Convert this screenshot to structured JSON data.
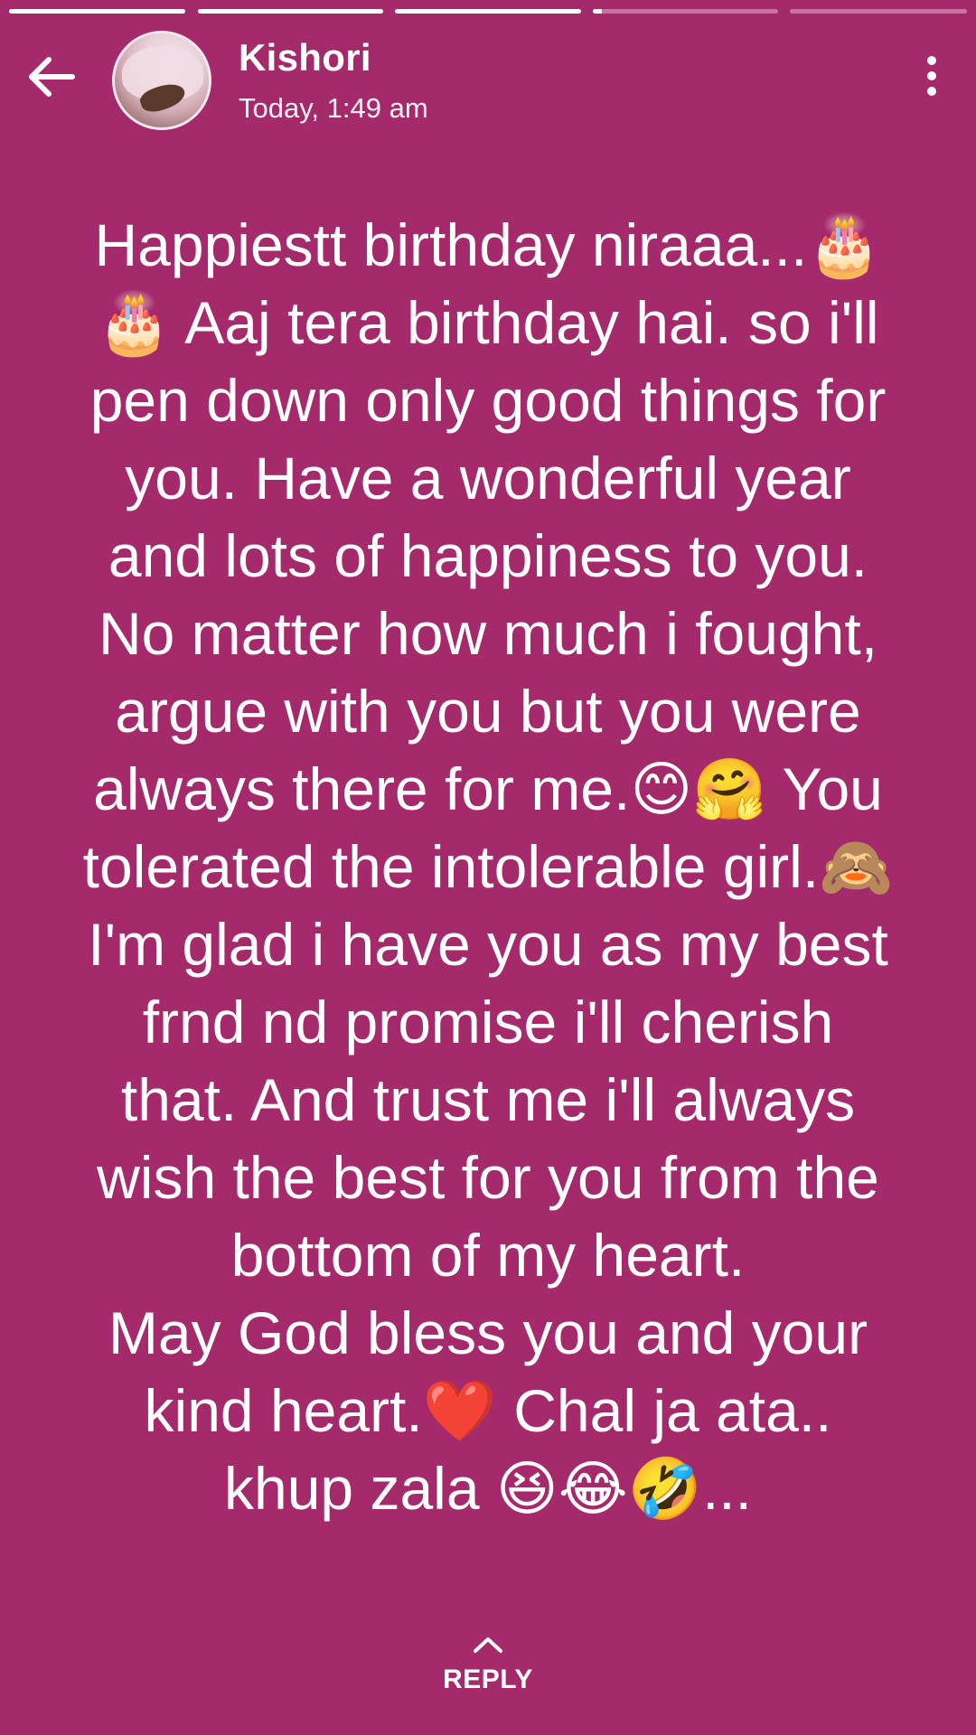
{
  "story": {
    "progress": [
      1.0,
      1.0,
      1.0,
      0.05,
      0.0
    ]
  },
  "header": {
    "name": "Kishori",
    "time": "Today, 1:49 am",
    "back_icon": "arrow-left-icon",
    "menu_icon": "more-vertical-icon"
  },
  "message": {
    "text": "Happiestt birthday niraaa...🎂\n🎂 Aaj tera birthday hai. so i'll\npen down only good things for\nyou. Have a wonderful year\nand lots of happiness to you.\nNo matter how much i fought,\nargue with you but you were\nalways  there for me.😊🤗 You\ntolerated the intolerable girl.🙈\nI'm glad i have you as my best\nfrnd nd promise i'll cherish\nthat. And trust me i'll always\nwish the best for you from the\nbottom of my heart.\nMay God bless you and your\nkind heart.❤️ Chal ja ata..\nkhup zala 😆😂🤣..."
  },
  "footer": {
    "reply_label": "REPLY",
    "reply_icon": "chevron-up-icon"
  },
  "colors": {
    "background": "#a52a6b",
    "text": "#ffffff"
  }
}
